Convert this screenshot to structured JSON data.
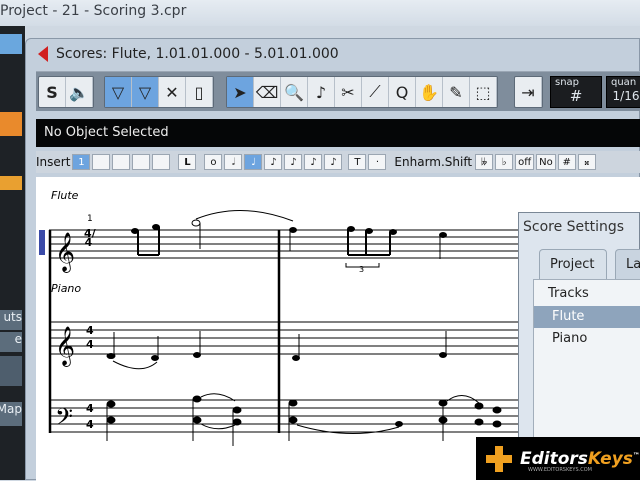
{
  "app_title": "Project - 21 - Scoring 3.cpr",
  "back_window": {
    "items": [
      "uts",
      "e",
      "Map"
    ]
  },
  "score_window": {
    "title": "Scores: Flute, 1.01.01.000 - 5.01.01.000",
    "toolbar": {
      "solo_label": "S",
      "snap": {
        "label": "snap",
        "value": "#"
      },
      "quantize": {
        "label": "quan",
        "value": "1/16"
      }
    },
    "info_line": "No Object Selected",
    "insert_bar": {
      "label": "Insert",
      "voice": "1",
      "l_button": "L",
      "t_button": "T",
      "dot_button": "·",
      "enharm_label": "Enharm.Shift",
      "enharm_buttons": [
        "𝄫",
        "♭",
        "off",
        "No",
        "#",
        "𝄪"
      ]
    },
    "score": {
      "staves": [
        "Flute",
        "Piano"
      ],
      "bar_number": "1",
      "tuplet": "3",
      "time_signature": "4/4"
    }
  },
  "score_settings": {
    "title": "Score Settings",
    "tabs": [
      "Project",
      "La"
    ],
    "tracks_header": "Tracks",
    "tracks": [
      "Flute",
      "Piano"
    ],
    "selected_track": "Flute"
  },
  "watermark": {
    "brand1": "Editors",
    "brand2": "Keys",
    "tm": "™",
    "url": "WWW.EDITORSKEYS.COM"
  }
}
